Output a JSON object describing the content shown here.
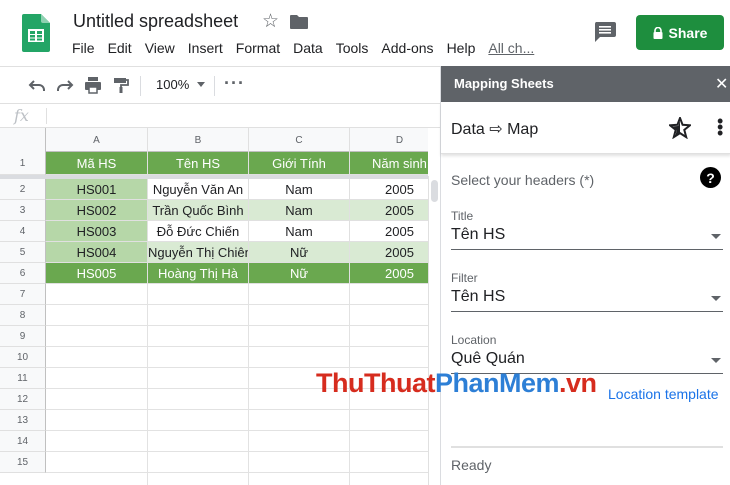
{
  "doc": {
    "title": "Untitled spreadsheet",
    "menu": [
      "File",
      "Edit",
      "View",
      "Insert",
      "Format",
      "Data",
      "Tools",
      "Add-ons",
      "Help"
    ],
    "last_edit": "All ch...",
    "share_label": "Share"
  },
  "toolbar": {
    "zoom": "100%",
    "more": "···"
  },
  "formula_bar": {
    "fx": "fx"
  },
  "grid": {
    "columns": [
      "A",
      "B",
      "C",
      "D"
    ],
    "rows": [
      "1",
      "2",
      "3",
      "4",
      "5",
      "6",
      "7",
      "8",
      "9",
      "10",
      "11",
      "12",
      "13",
      "14",
      "15"
    ],
    "header": [
      "Mã HS",
      "Tên HS",
      "Giới Tính",
      "Năm sinh"
    ],
    "data": [
      [
        "HS001",
        "Nguyễn Văn An",
        "Nam",
        "2005"
      ],
      [
        "HS002",
        "Trần Quốc Bình",
        "Nam",
        "2005"
      ],
      [
        "HS003",
        "Đỗ Đức Chiến",
        "Nam",
        "2005"
      ],
      [
        "HS004",
        "Nguyễn Thị Chiên",
        "Nữ",
        "2005"
      ],
      [
        "HS005",
        "Hoàng Thị Hà",
        "Nữ",
        "2005"
      ]
    ]
  },
  "panel": {
    "title": "Mapping Sheets",
    "close": "✕",
    "subtitle": "Data ⇨ Map",
    "select_headers": "Select your headers (*)",
    "help": "?",
    "fields": [
      {
        "label": "Title",
        "value": "Tên HS"
      },
      {
        "label": "Filter",
        "value": "Tên HS"
      },
      {
        "label": "Location",
        "value": "Quê Quán"
      }
    ],
    "location_template": "Location template",
    "status": "Ready"
  },
  "watermark": {
    "part1": "ThuThuat",
    "part2": "PhanMem",
    "part3": ".vn"
  },
  "colors": {
    "header_green": "#6aa84f",
    "row_white": "#ffffff",
    "row_light": "#d9ead3",
    "colA_light": "#b6d7a8",
    "share_green": "#1e8e3e",
    "panel_header": "#5f6368",
    "link_blue": "#1a73e8"
  }
}
